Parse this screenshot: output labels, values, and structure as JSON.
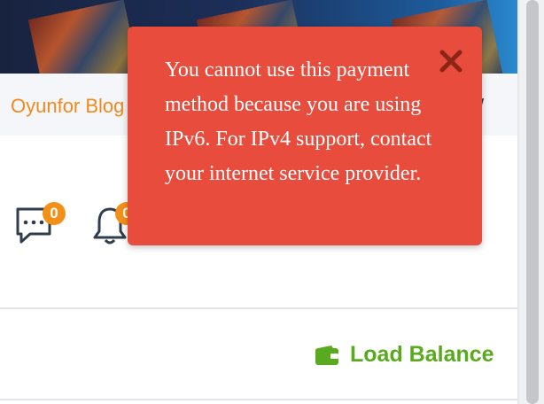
{
  "header": {
    "blog_link": "Oyunfor Blog",
    "nav_tail_fragment": "/"
  },
  "notifications": {
    "messages_icon": "chat-bubble-icon",
    "messages_count": "0",
    "bell_icon": "bell-icon",
    "bell_count": "0"
  },
  "wallet": {
    "icon": "wallet-icon",
    "load_balance_label": "Load Balance"
  },
  "toast": {
    "message": "You cannot use this payment method because you are using IPv6. For IPv4 support, contact your internet service provider.",
    "close_icon": "close-icon"
  },
  "colors": {
    "accent_orange": "#f08a1c",
    "badge_orange": "#f39019",
    "toast_red": "#e74c3c",
    "wallet_green": "#5aaa1f"
  }
}
